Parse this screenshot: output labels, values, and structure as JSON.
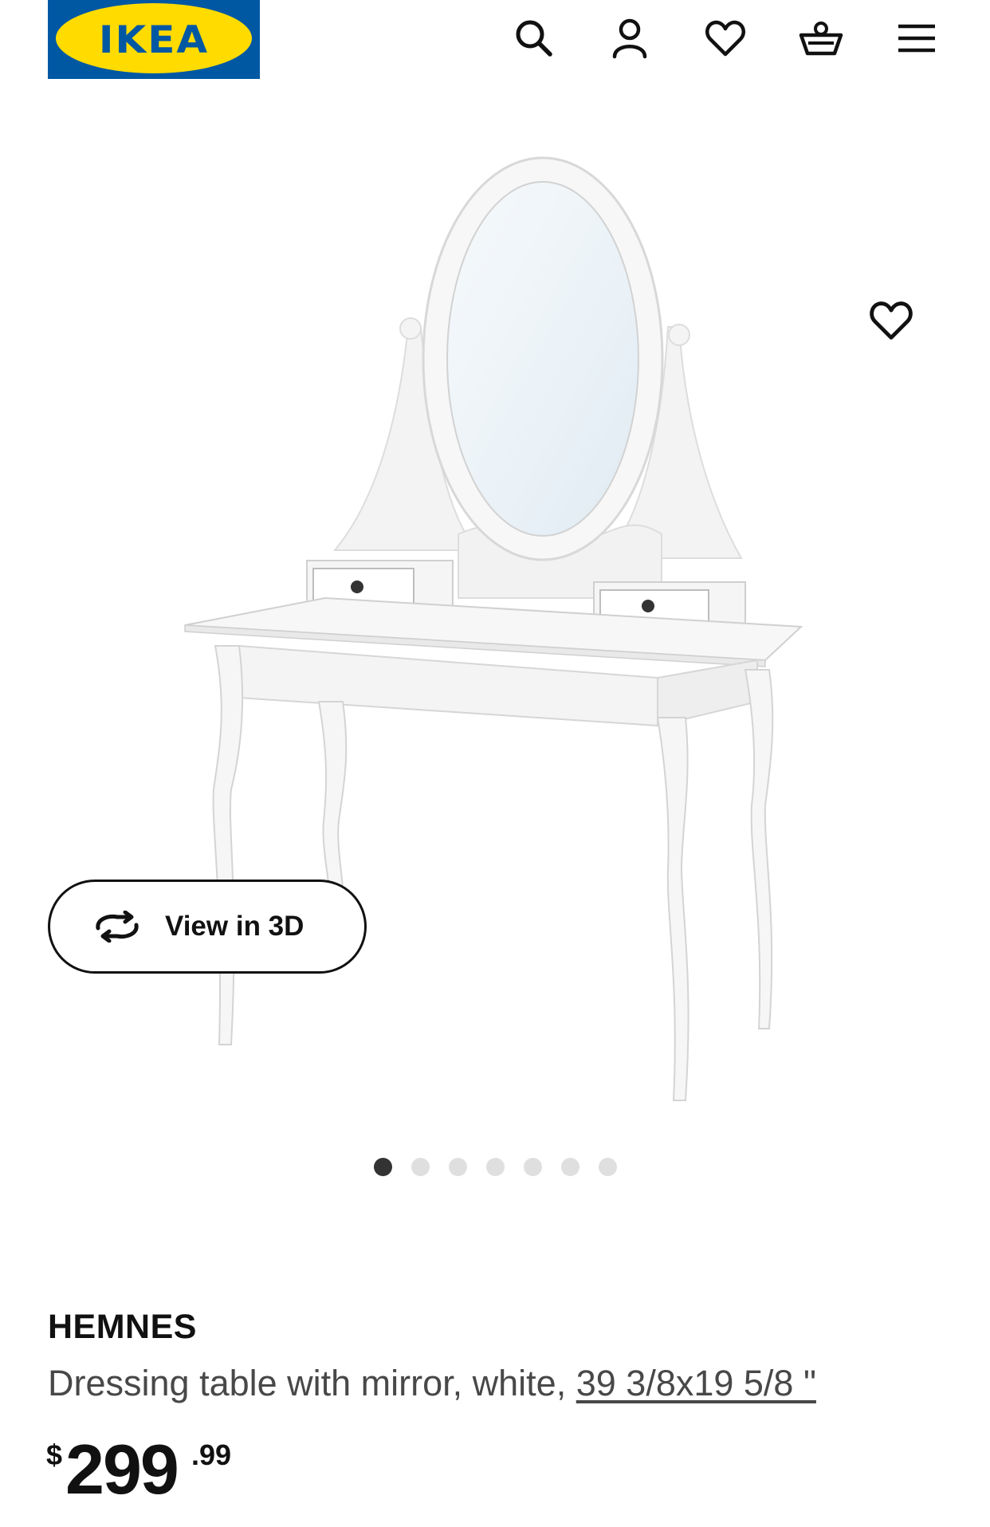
{
  "header": {
    "logo_text": "IKEA",
    "icons": [
      "search-icon",
      "account-icon",
      "heart-icon",
      "basket-icon",
      "menu-icon"
    ]
  },
  "product_image": {
    "favorite_icon": "heart-icon",
    "view_3d_label": "View in 3D",
    "carousel": {
      "total": 7,
      "active_index": 0
    }
  },
  "product": {
    "name": "HEMNES",
    "description": "Dressing table with mirror, white,",
    "dimensions": "39 3/8x19 5/8 \"",
    "price": {
      "currency": "$",
      "integer": "299",
      "decimal": ".99"
    }
  },
  "colors": {
    "brand_blue": "#0058A3",
    "brand_yellow": "#FFDB00",
    "text": "#111111",
    "text_secondary": "#484848"
  }
}
